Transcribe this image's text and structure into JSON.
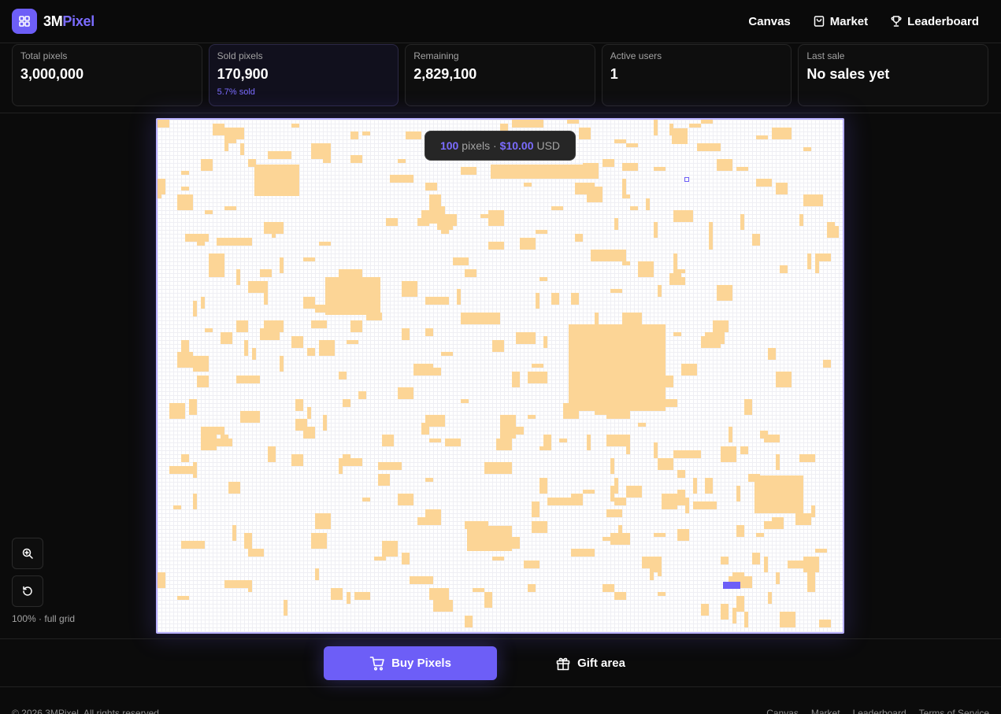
{
  "brand": {
    "name_main": "3M",
    "name_accent": "Pixel"
  },
  "nav": {
    "canvas": "Canvas",
    "market": "Market",
    "leaderboard": "Leaderboard"
  },
  "stats": [
    {
      "label": "Total pixels",
      "value": "3,000,000"
    },
    {
      "label": "Sold pixels",
      "value": "170,900",
      "sub": "5.7% sold"
    },
    {
      "label": "Remaining",
      "value": "2,829,100"
    },
    {
      "label": "Active users",
      "value": "1"
    },
    {
      "label": "Last sale",
      "value": "No sales yet"
    }
  ],
  "tooltip": {
    "count": "100",
    "unit": "pixels ·",
    "price": "$10.00",
    "currency": "USD"
  },
  "zoom": {
    "label": "100% · full grid"
  },
  "actions": {
    "buy": "Buy Pixels",
    "gift": "Gift area"
  },
  "footer": {
    "copyright": "© 2026 3MPixel. All rights reserved.",
    "links": [
      "Canvas",
      "Market",
      "Leaderboard",
      "Terms of Service"
    ]
  },
  "colors": {
    "accent": "#6d5ef7",
    "sold_pixel": "#fcd596",
    "canvas_bg": "#ffffff",
    "page_bg": "#0b0b0b"
  }
}
